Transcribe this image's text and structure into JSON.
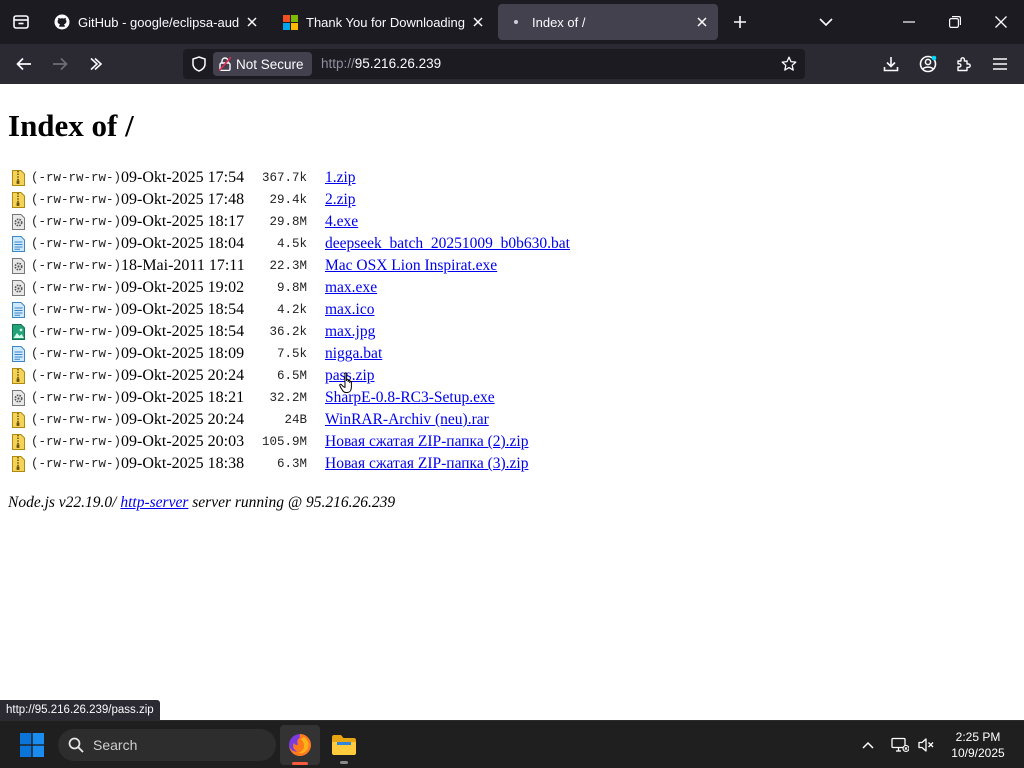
{
  "browser": {
    "tabs": [
      {
        "title": "GitHub - google/eclipsa-audio-",
        "favicon": "github-icon",
        "active": false
      },
      {
        "title": "Thank You for Downloading Vis",
        "favicon": "microsoft-icon",
        "active": false
      },
      {
        "title": "Index of /",
        "favicon": "loading-dot-icon",
        "active": true
      }
    ],
    "urlbar": {
      "security_label": "Not Secure",
      "url_protocol": "http://",
      "url_host": "95.216.26.239"
    }
  },
  "page": {
    "heading": "Index of /",
    "files": [
      {
        "icon": "zip-icon",
        "perms": "(-rw-rw-rw-)",
        "date": "09-Okt-2025 17:54",
        "size": "367.7k",
        "name": "1.zip"
      },
      {
        "icon": "zip-icon",
        "perms": "(-rw-rw-rw-)",
        "date": "09-Okt-2025 17:48",
        "size": "29.4k",
        "name": "2.zip"
      },
      {
        "icon": "exe-icon",
        "perms": "(-rw-rw-rw-)",
        "date": "09-Okt-2025 18:17",
        "size": "29.8M",
        "name": "4.exe"
      },
      {
        "icon": "text-file-icon",
        "perms": "(-rw-rw-rw-)",
        "date": "09-Okt-2025 18:04",
        "size": "4.5k",
        "name": "deepseek_batch_20251009_b0b630.bat"
      },
      {
        "icon": "exe-icon",
        "perms": "(-rw-rw-rw-)",
        "date": "18-Mai-2011 17:11",
        "size": "22.3M",
        "name": "Mac OSX Lion Inspirat.exe"
      },
      {
        "icon": "exe-icon",
        "perms": "(-rw-rw-rw-)",
        "date": "09-Okt-2025 19:02",
        "size": "9.8M",
        "name": "max.exe"
      },
      {
        "icon": "text-file-icon",
        "perms": "(-rw-rw-rw-)",
        "date": "09-Okt-2025 18:54",
        "size": "4.2k",
        "name": "max.ico"
      },
      {
        "icon": "image-file-icon",
        "perms": "(-rw-rw-rw-)",
        "date": "09-Okt-2025 18:54",
        "size": "36.2k",
        "name": "max.jpg"
      },
      {
        "icon": "text-file-icon",
        "perms": "(-rw-rw-rw-)",
        "date": "09-Okt-2025 18:09",
        "size": "7.5k",
        "name": "nigga.bat"
      },
      {
        "icon": "zip-icon",
        "perms": "(-rw-rw-rw-)",
        "date": "09-Okt-2025 20:24",
        "size": "6.5M",
        "name": "pass.zip"
      },
      {
        "icon": "exe-icon",
        "perms": "(-rw-rw-rw-)",
        "date": "09-Okt-2025 18:21",
        "size": "32.2M",
        "name": "SharpE-0.8-RC3-Setup.exe"
      },
      {
        "icon": "zip-icon",
        "perms": "(-rw-rw-rw-)",
        "date": "09-Okt-2025 20:24",
        "size": "24B",
        "name": "WinRAR-Archiv (neu).rar"
      },
      {
        "icon": "zip-icon",
        "perms": "(-rw-rw-rw-)",
        "date": "09-Okt-2025 20:03",
        "size": "105.9M",
        "name": "Новая сжатая ZIP-папка (2).zip"
      },
      {
        "icon": "zip-icon",
        "perms": "(-rw-rw-rw-)",
        "date": "09-Okt-2025 18:38",
        "size": "6.3M",
        "name": "Новая сжатая ZIP-папка (3).zip"
      }
    ],
    "footer": {
      "prefix": "Node.js v22.19.0/ ",
      "link": "http-server",
      "suffix": " server running @ 95.216.26.239"
    }
  },
  "status_bar_url": "http://95.216.26.239/pass.zip",
  "taskbar": {
    "search_placeholder": "Search",
    "clock_time": "2:25 PM",
    "clock_date": "10/9/2025"
  },
  "colors": {
    "link": "#0000ee",
    "tabstrip_bg": "#1c1b22",
    "navbar_bg": "#2b2a33",
    "firefox_accent": "#f85a3e",
    "windows_blue": "#0a74d8"
  }
}
